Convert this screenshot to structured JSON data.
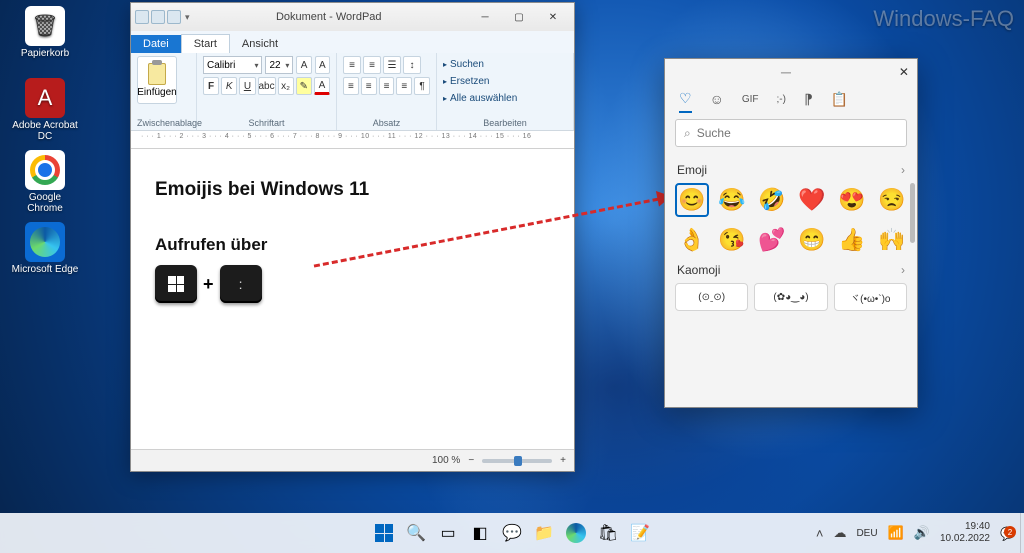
{
  "watermark": "Windows-FAQ",
  "desktop": {
    "icons": [
      {
        "label": "Papierkorb",
        "glyph": "🗑"
      },
      {
        "label": "Adobe Acrobat DC",
        "glyph": "A"
      },
      {
        "label": "Google Chrome"
      },
      {
        "label": "Microsoft Edge"
      }
    ]
  },
  "wordpad": {
    "title": "Dokument - WordPad",
    "tabs": {
      "file": "Datei",
      "start": "Start",
      "view": "Ansicht"
    },
    "ribbon": {
      "paste": "Einfügen",
      "clipboard_label": "Zwischenablage",
      "font_name": "Calibri",
      "font_size": "22",
      "font_label": "Schriftart",
      "para_label": "Absatz",
      "edit_label": "Bearbeiten",
      "find": "Suchen",
      "replace": "Ersetzen",
      "select_all": "Alle auswählen"
    },
    "ruler": "· · · 1 · · · 2 · · · 3 · · · 4 · · · 5 · · · 6 · · · 7 · · · 8 · · · 9 · · · 10 · · · 11 · · · 12 · · · 13 · · · 14 · · · 15 · · · 16",
    "doc": {
      "heading1": "Emoijis bei Windows 11",
      "heading2": "Aufrufen über",
      "plus": "+"
    },
    "status": {
      "zoom": "100 %",
      "minus": "−",
      "plus": "+"
    }
  },
  "emoji_panel": {
    "handle": "─",
    "close": "✕",
    "tabs": [
      "♡",
      "☺",
      "GIF",
      ";-)",
      "⁋",
      "📋"
    ],
    "search_placeholder": "Suche",
    "emoji_label": "Emoji",
    "kaomoji_label": "Kaomoji",
    "emojis": [
      "😊",
      "😂",
      "🤣",
      "❤️",
      "😍",
      "😒",
      "👌",
      "😘",
      "💕",
      "😁",
      "👍",
      "🙌"
    ],
    "kaomoji": [
      "(⊙ˍ⊙)",
      "(✿◕‿◕)",
      "ヾ(•ω•`)o"
    ]
  },
  "taskbar": {
    "tray": {
      "lang": "DEU",
      "time": "19:40",
      "date": "10.02.2022",
      "badge": "2"
    }
  }
}
